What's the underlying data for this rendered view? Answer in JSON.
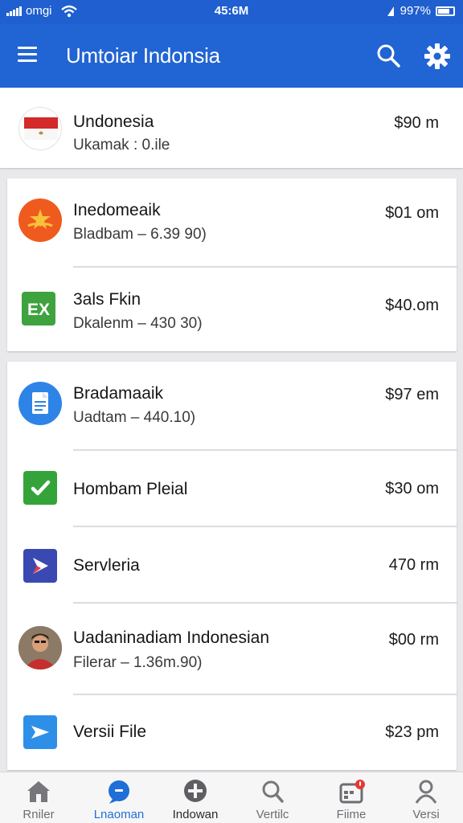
{
  "status_bar": {
    "carrier": "omgi",
    "time": "45:6M",
    "battery": "997%"
  },
  "app_bar": {
    "title": "Umtoiar Indonsia",
    "search_icon": "search-icon",
    "settings_icon": "gear-icon"
  },
  "items": [
    {
      "title": "Undonesia",
      "subtitle": "Ukamak : 0.ile",
      "price": "$90 m",
      "icon": "indonesia-flag-icon"
    },
    {
      "title": "Inedomeaik",
      "subtitle": "Bladbam – 6.39 90)",
      "price": "$01 om",
      "icon": "star-icon"
    },
    {
      "title": "3als Fkin",
      "subtitle": "Dkalenm – 430 30)",
      "price": "$40.om",
      "icon": "excel-icon"
    },
    {
      "title": "Bradamaaik",
      "subtitle": "Uadtam – 440.10)",
      "price": "$97 em",
      "icon": "document-icon"
    },
    {
      "title": "Hombam Pleial",
      "subtitle": "",
      "price": "$30 om",
      "icon": "checkmark-icon"
    },
    {
      "title": "Servleria",
      "subtitle": "",
      "price": "470 rm",
      "icon": "play-icon"
    },
    {
      "title": "Uadaninadiam Indonesian",
      "subtitle": "Filerar – 1.36m.90)",
      "price": "$00 rm",
      "icon": "person-photo-icon"
    },
    {
      "title": "Versii File",
      "subtitle": "",
      "price": "$23 pm",
      "icon": "mail-icon"
    }
  ],
  "bottom_nav": [
    {
      "label": "Rniler",
      "icon": "home-icon",
      "active": false
    },
    {
      "label": "Lnaoman",
      "icon": "chat-icon",
      "active": true
    },
    {
      "label": "Indowan",
      "icon": "download-icon",
      "active": false
    },
    {
      "label": "Vertilc",
      "icon": "search-icon",
      "active": false
    },
    {
      "label": "Fiime",
      "icon": "calendar-icon",
      "active": false
    },
    {
      "label": "Versi",
      "icon": "profile-icon",
      "active": false
    }
  ],
  "colors": {
    "primary": "#2164d3",
    "active_nav": "#1f6fd6",
    "badge": "#e53935"
  }
}
